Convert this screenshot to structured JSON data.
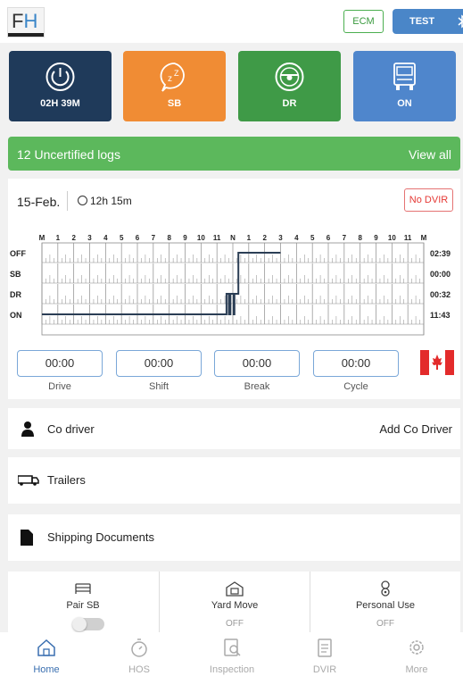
{
  "header": {
    "logo_text_f": "F",
    "logo_text_h": "H",
    "ecm_label": "ECM",
    "test_label": "TEST",
    "bluetooth_icon": "bluetooth-icon"
  },
  "status_buttons": [
    {
      "label": "02H 39M",
      "icon": "power-icon",
      "color": "#1f3a5a"
    },
    {
      "label": "SB",
      "icon": "sleep-icon",
      "color": "#f08c34"
    },
    {
      "label": "DR",
      "icon": "steering-wheel-icon",
      "color": "#3f9a47"
    },
    {
      "label": "ON",
      "icon": "truck-icon",
      "color": "#4f86cc"
    }
  ],
  "uncertified": {
    "text": "12 Uncertified logs",
    "link": "View all"
  },
  "log": {
    "date": "15-Feb.",
    "duration": "12h 15m",
    "no_dvir": "No DVIR",
    "hour_labels": [
      "M",
      "1",
      "2",
      "3",
      "4",
      "5",
      "6",
      "7",
      "8",
      "9",
      "10",
      "11",
      "N",
      "1",
      "2",
      "3",
      "4",
      "5",
      "6",
      "7",
      "8",
      "9",
      "10",
      "11",
      "M"
    ],
    "rows": [
      {
        "status": "OFF",
        "total": "02:39"
      },
      {
        "status": "SB",
        "total": "00:00"
      },
      {
        "status": "DR",
        "total": "00:32"
      },
      {
        "status": "ON",
        "total": "11:43"
      }
    ],
    "counters": [
      {
        "value": "00:00",
        "label": "Drive"
      },
      {
        "value": "00:00",
        "label": "Shift"
      },
      {
        "value": "00:00",
        "label": "Break"
      },
      {
        "value": "00:00",
        "label": "Cycle"
      }
    ],
    "flag_icon": "canada-flag-icon",
    "colors": {
      "line": "#2b3e55",
      "grid": "#8a8a8a"
    }
  },
  "co_driver": {
    "label": "Co driver",
    "action": "Add Co Driver"
  },
  "trailers": {
    "label": "Trailers"
  },
  "shipping": {
    "label": "Shipping Documents"
  },
  "toggles": [
    {
      "label": "Pair SB",
      "value": ""
    },
    {
      "label": "Yard Move",
      "value": "OFF"
    },
    {
      "label": "Personal Use",
      "value": "OFF"
    }
  ],
  "tabs": [
    {
      "label": "Home",
      "active": true
    },
    {
      "label": "HOS",
      "active": false
    },
    {
      "label": "Inspection",
      "active": false
    },
    {
      "label": "DVIR",
      "active": false
    },
    {
      "label": "More",
      "active": false
    }
  ]
}
